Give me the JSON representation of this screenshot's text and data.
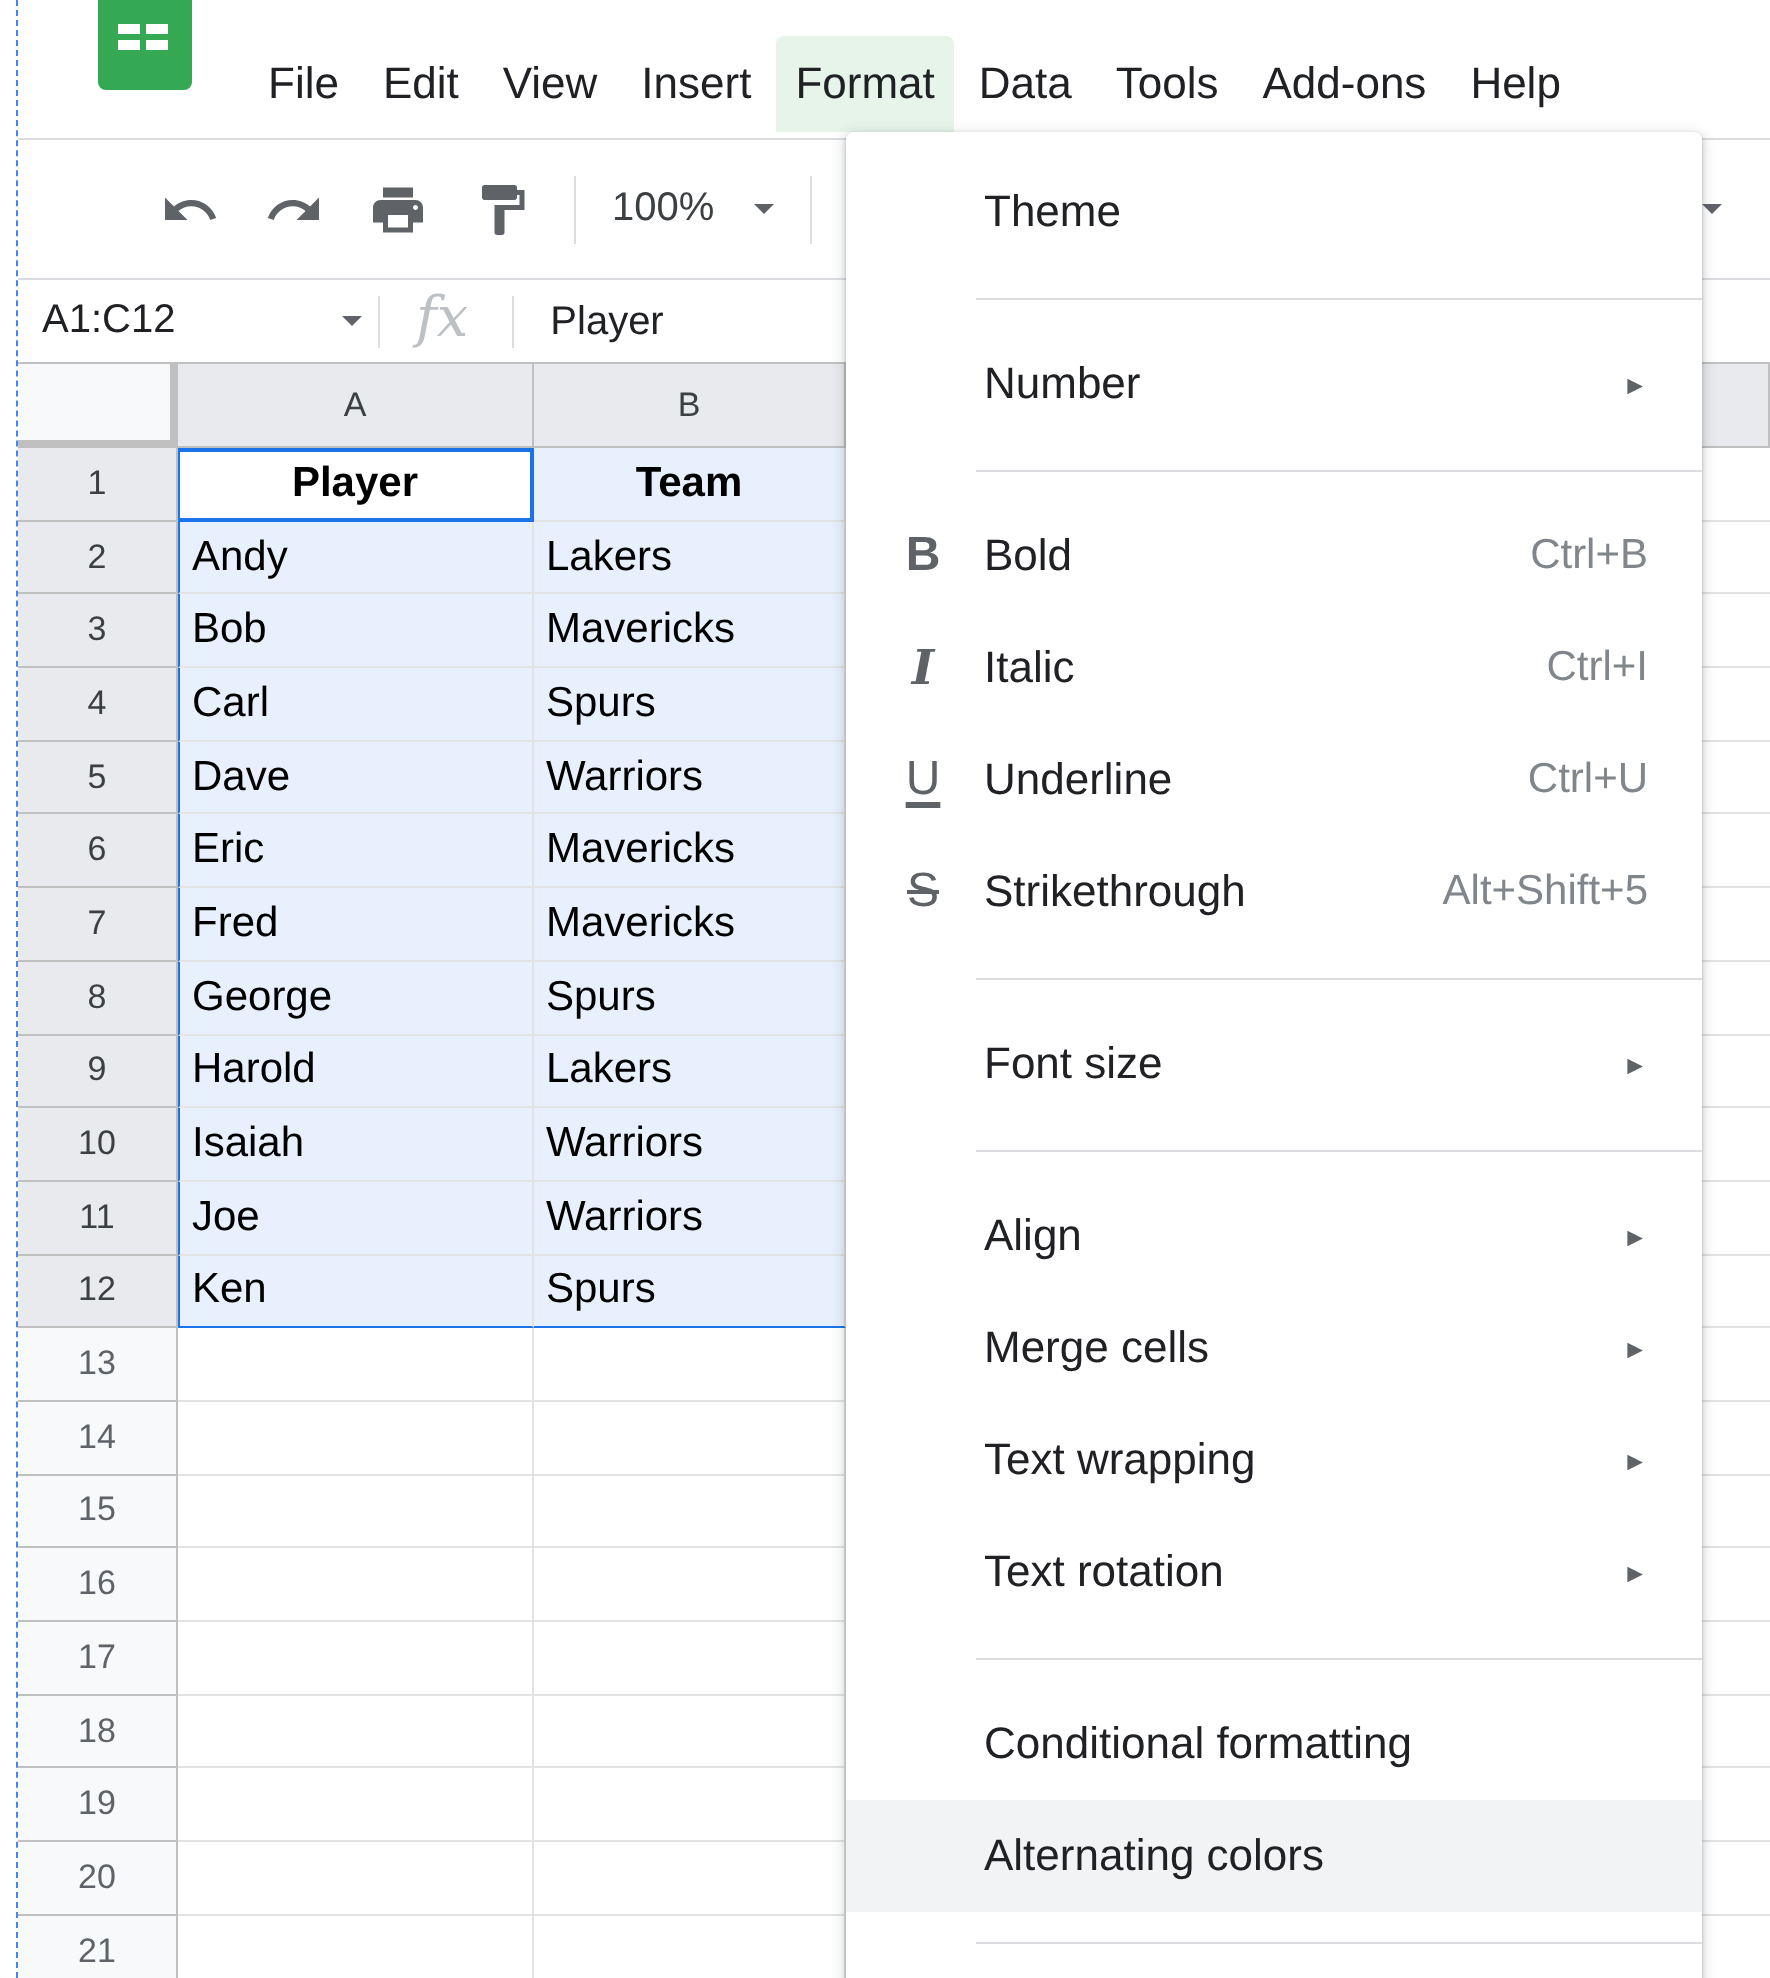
{
  "menubar": [
    {
      "label": "File",
      "selected": false
    },
    {
      "label": "Edit",
      "selected": false
    },
    {
      "label": "View",
      "selected": false
    },
    {
      "label": "Insert",
      "selected": false
    },
    {
      "label": "Format",
      "selected": true
    },
    {
      "label": "Data",
      "selected": false
    },
    {
      "label": "Tools",
      "selected": false
    },
    {
      "label": "Add-ons",
      "selected": false
    },
    {
      "label": "Help",
      "selected": false
    }
  ],
  "toolbar": {
    "zoom": "100%"
  },
  "formula_bar": {
    "name_box": "A1:C12",
    "fx": "fx",
    "value": "Player"
  },
  "sheet": {
    "columns": [
      {
        "label": "A",
        "selected": true
      },
      {
        "label": "B",
        "selected": true
      }
    ],
    "rows": [
      {
        "number": "1",
        "selected": true,
        "header": true,
        "cells": [
          {
            "text": "Player",
            "active": true
          },
          {
            "text": "Team",
            "active": false
          }
        ]
      },
      {
        "number": "2",
        "selected": true,
        "header": false,
        "cells": [
          {
            "text": "Andy",
            "active": false
          },
          {
            "text": "Lakers",
            "active": false
          }
        ]
      },
      {
        "number": "3",
        "selected": true,
        "header": false,
        "cells": [
          {
            "text": "Bob",
            "active": false
          },
          {
            "text": "Mavericks",
            "active": false
          }
        ]
      },
      {
        "number": "4",
        "selected": true,
        "header": false,
        "cells": [
          {
            "text": "Carl",
            "active": false
          },
          {
            "text": "Spurs",
            "active": false
          }
        ]
      },
      {
        "number": "5",
        "selected": true,
        "header": false,
        "cells": [
          {
            "text": "Dave",
            "active": false
          },
          {
            "text": "Warriors",
            "active": false
          }
        ]
      },
      {
        "number": "6",
        "selected": true,
        "header": false,
        "cells": [
          {
            "text": "Eric",
            "active": false
          },
          {
            "text": "Mavericks",
            "active": false
          }
        ]
      },
      {
        "number": "7",
        "selected": true,
        "header": false,
        "cells": [
          {
            "text": "Fred",
            "active": false
          },
          {
            "text": "Mavericks",
            "active": false
          }
        ]
      },
      {
        "number": "8",
        "selected": true,
        "header": false,
        "cells": [
          {
            "text": "George",
            "active": false
          },
          {
            "text": "Spurs",
            "active": false
          }
        ]
      },
      {
        "number": "9",
        "selected": true,
        "header": false,
        "cells": [
          {
            "text": "Harold",
            "active": false
          },
          {
            "text": "Lakers",
            "active": false
          }
        ]
      },
      {
        "number": "10",
        "selected": true,
        "header": false,
        "cells": [
          {
            "text": "Isaiah",
            "active": false
          },
          {
            "text": "Warriors",
            "active": false
          }
        ]
      },
      {
        "number": "11",
        "selected": true,
        "header": false,
        "cells": [
          {
            "text": "Joe",
            "active": false
          },
          {
            "text": "Warriors",
            "active": false
          }
        ]
      },
      {
        "number": "12",
        "selected": true,
        "header": false,
        "cells": [
          {
            "text": "Ken",
            "active": false
          },
          {
            "text": "Spurs",
            "active": false
          }
        ]
      },
      {
        "number": "13",
        "selected": false
      },
      {
        "number": "14",
        "selected": false
      },
      {
        "number": "15",
        "selected": false
      },
      {
        "number": "16",
        "selected": false
      },
      {
        "number": "17",
        "selected": false
      },
      {
        "number": "18",
        "selected": false
      },
      {
        "number": "19",
        "selected": false
      },
      {
        "number": "20",
        "selected": false
      },
      {
        "number": "21",
        "selected": false
      }
    ]
  },
  "format_menu": [
    {
      "kind": "item",
      "label": "Theme",
      "highlighted": false
    },
    {
      "kind": "divider"
    },
    {
      "kind": "item",
      "label": "Number",
      "arrow": "►",
      "highlighted": false
    },
    {
      "kind": "divider"
    },
    {
      "kind": "item",
      "label": "Bold",
      "glyph": "B",
      "shortcut": "Ctrl+B",
      "highlighted": false
    },
    {
      "kind": "item",
      "label": "Italic",
      "glyph": "I",
      "shortcut": "Ctrl+I",
      "highlighted": false
    },
    {
      "kind": "item",
      "label": "Underline",
      "glyph": "U",
      "shortcut": "Ctrl+U",
      "highlighted": false
    },
    {
      "kind": "item",
      "label": "Strikethrough",
      "glyph": "S",
      "shortcut": "Alt+Shift+5",
      "highlighted": false
    },
    {
      "kind": "divider"
    },
    {
      "kind": "item",
      "label": "Font size",
      "arrow": "►",
      "highlighted": false
    },
    {
      "kind": "divider"
    },
    {
      "kind": "item",
      "label": "Align",
      "arrow": "►",
      "highlighted": false
    },
    {
      "kind": "item",
      "label": "Merge cells",
      "arrow": "►",
      "highlighted": false
    },
    {
      "kind": "item",
      "label": "Text wrapping",
      "arrow": "►",
      "highlighted": false
    },
    {
      "kind": "item",
      "label": "Text rotation",
      "arrow": "►",
      "highlighted": false
    },
    {
      "kind": "divider"
    },
    {
      "kind": "item",
      "label": "Conditional formatting",
      "highlighted": false
    },
    {
      "kind": "item",
      "label": "Alternating colors",
      "highlighted": true
    },
    {
      "kind": "divider"
    }
  ]
}
